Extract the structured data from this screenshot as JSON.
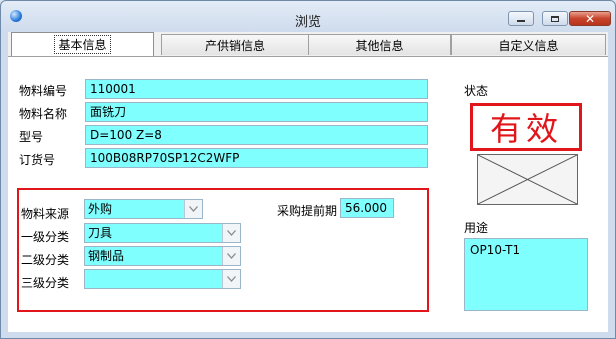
{
  "window": {
    "title": "浏览",
    "close_symbol": "✕"
  },
  "tabs": [
    {
      "label": "基本信息",
      "active": true
    },
    {
      "label": "产供销信息",
      "active": false
    },
    {
      "label": "其他信息",
      "active": false
    },
    {
      "label": "自定义信息",
      "active": false
    }
  ],
  "basic": {
    "material_code_label": "物料编号",
    "material_code": "110001",
    "material_name_label": "物料名称",
    "material_name": "面铣刀",
    "model_label": "型号",
    "model": "D=100 Z=8",
    "order_no_label": "订货号",
    "order_no": "100B08RP70SP12C2WFP"
  },
  "classification": {
    "source_label": "物料来源",
    "source": "外购",
    "lead_time_label": "采购提前期",
    "lead_time": "56.000",
    "level1_label": "一级分类",
    "level1": "刀具",
    "level2_label": "二级分类",
    "level2": "钢制品",
    "level3_label": "三级分类",
    "level3": ""
  },
  "status": {
    "label": "状态",
    "value": "有效"
  },
  "usage": {
    "label": "用途",
    "value": "OP10-T1"
  },
  "colors": {
    "field_bg": "#80ffff",
    "highlight": "#e0161b"
  }
}
